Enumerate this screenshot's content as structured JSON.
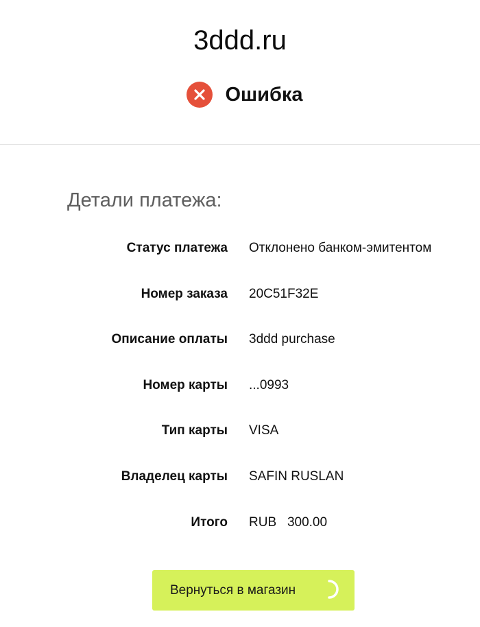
{
  "header": {
    "site_title": "3ddd.ru",
    "status_title": "Ошибка",
    "status_icon": "error-x-icon",
    "status_color": "#e5503a"
  },
  "details": {
    "heading": "Детали платежа:",
    "rows": [
      {
        "label": "Статус платежа",
        "value": "Отклонено банком-эмитентом"
      },
      {
        "label": "Номер заказа",
        "value": "20C51F32E"
      },
      {
        "label": "Описание оплаты",
        "value": "3ddd purchase"
      },
      {
        "label": "Номер карты",
        "value": "...0993"
      },
      {
        "label": "Тип карты",
        "value": "VISA"
      },
      {
        "label": "Владелец карты",
        "value": "SAFIN RUSLAN"
      },
      {
        "label": "Итого",
        "value": "RUB   300.00"
      }
    ]
  },
  "actions": {
    "back_label": "Вернуться в магазин",
    "button_color": "#d6f15a",
    "spinner_icon": "loading-spinner-icon"
  }
}
